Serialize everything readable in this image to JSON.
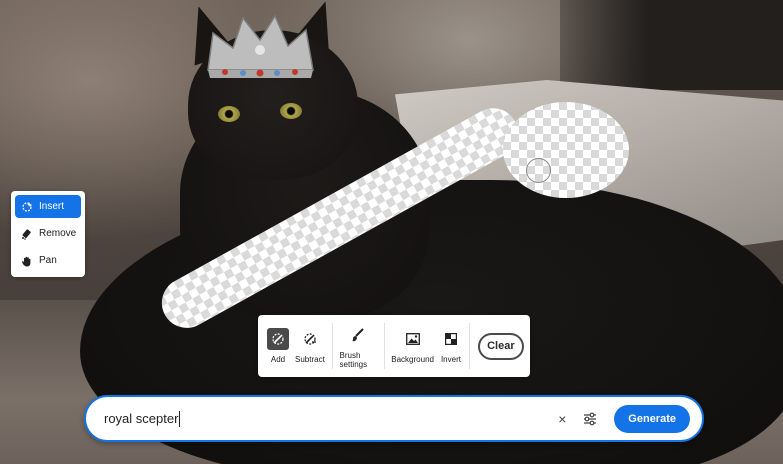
{
  "tool_menu": {
    "items": [
      {
        "label": "Insert",
        "icon": "insert-icon",
        "active": true
      },
      {
        "label": "Remove",
        "icon": "remove-icon",
        "active": false
      },
      {
        "label": "Pan",
        "icon": "pan-hand-icon",
        "active": false
      }
    ]
  },
  "brush_toolbar": {
    "add_label": "Add",
    "subtract_label": "Subtract",
    "brush_settings_label": "Brush settings",
    "background_label": "Background",
    "invert_label": "Invert",
    "clear_label": "Clear"
  },
  "prompt": {
    "value": "royal scepter",
    "clear_icon": "×",
    "generate_label": "Generate"
  },
  "colors": {
    "accent": "#1473e6",
    "selected_tool_bg": "#4a4a4a"
  }
}
